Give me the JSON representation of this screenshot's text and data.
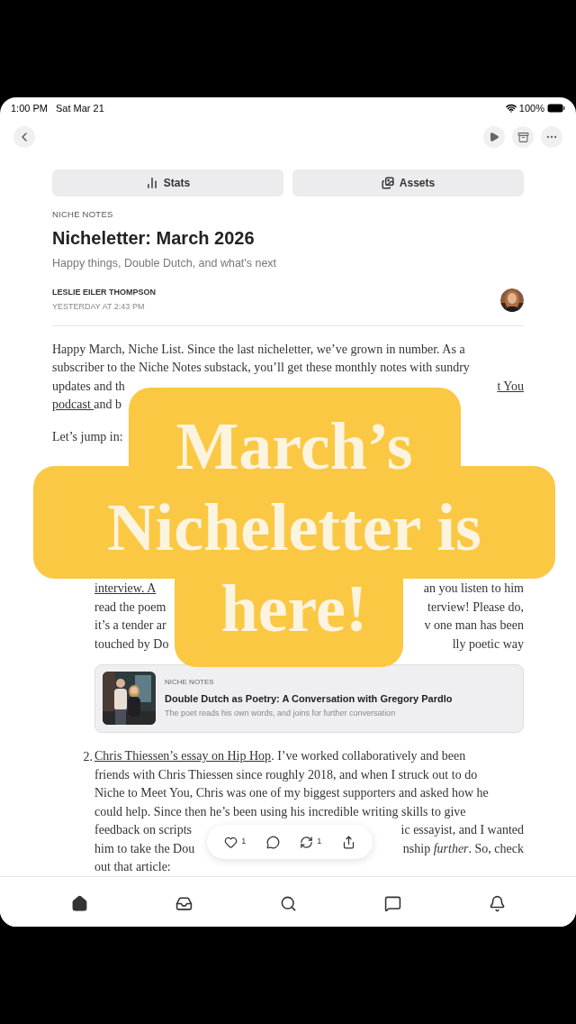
{
  "status_bar": {
    "time": "1:00 PM",
    "date": "Sat Mar 21",
    "battery": "100%"
  },
  "header_buttons": [
    {
      "label": "Stats",
      "kind": "stats"
    },
    {
      "label": "Assets",
      "kind": "assets"
    }
  ],
  "post": {
    "publication": "NICHE NOTES",
    "title": "Nicheletter: March 2026",
    "subtitle": "Happy things, Double Dutch, and what's next",
    "author": "LESLIE EILER THOMPSON",
    "time": "YESTERDAY AT 2:43 PM"
  },
  "intro_lines": [
    {
      "left": [
        {
          "text": "Happy March, Niche List. Since the last nicheletter, we’ve grown in number. As a",
          "link": false
        }
      ]
    },
    {
      "left": [
        {
          "text": "subscriber to the Niche Notes substack, you’ll get these monthly notes with sundry",
          "link": false
        }
      ]
    },
    {
      "left": [
        {
          "text": "updates and th",
          "link": false
        }
      ],
      "right": [
        {
          "text": "t You",
          "link": true
        }
      ]
    },
    {
      "left": [
        {
          "text": "podcast ",
          "link": true
        },
        {
          "text": "and b",
          "link": false
        }
      ]
    }
  ],
  "jump_line": "Let’s jump in:",
  "item1_lines": [
    {
      "left": [
        {
          "text": "interview. A",
          "link": true
        }
      ],
      "right": [
        {
          "text": "an you listen to him",
          "link": false
        }
      ]
    },
    {
      "left": [
        {
          "text": "read the poem",
          "link": false
        }
      ],
      "right": [
        {
          "text": "terview! Please do,",
          "link": false
        }
      ]
    },
    {
      "left": [
        {
          "text": "it’s a tender ar",
          "link": false
        }
      ],
      "right": [
        {
          "text": "v one man has been",
          "link": false
        }
      ]
    },
    {
      "left": [
        {
          "text": "touched by Do",
          "link": false
        }
      ],
      "right": [
        {
          "text": "lly poetic way",
          "link": false
        }
      ]
    }
  ],
  "embed": {
    "publication": "NICHE NOTES",
    "title": "Double Dutch as Poetry: A Conversation with Gregory Pardlo",
    "subtitle": "The poet reads his own words, and joins for further conversation",
    "kind": "picture"
  },
  "item2": {
    "number": "2.",
    "lines": [
      {
        "left": [
          {
            "text": "Chris Thiessen’s essay on Hip Hop",
            "link": true
          },
          {
            "text": ". I’ve worked collaboratively and been",
            "link": false
          }
        ]
      },
      {
        "left": [
          {
            "text": "friends with Chris Thiessen since roughly 2018, and when I struck out to do",
            "link": false
          }
        ]
      },
      {
        "left": [
          {
            "text": "Niche to Meet You, Chris was one of my biggest supporters and asked how he",
            "link": false
          }
        ]
      },
      {
        "left": [
          {
            "text": "could help. Since then he’s been using his incredible writing skills to give",
            "link": false
          }
        ]
      },
      {
        "left": [
          {
            "text": "feedback on scripts",
            "link": false
          }
        ],
        "right": [
          {
            "text": "ic essayist, and I wanted",
            "link": false
          }
        ]
      },
      {
        "left": [
          {
            "text": "him to take the Dou",
            "link": false
          }
        ],
        "right": [
          {
            "text": "nship *further*. So, check",
            "link": false
          }
        ]
      },
      {
        "left": [
          {
            "text": "out that article:",
            "link": false
          }
        ]
      }
    ]
  },
  "reactions": [
    {
      "kind": "like",
      "count": "1"
    },
    {
      "kind": "comment"
    },
    {
      "kind": "restack",
      "count": "1"
    },
    {
      "kind": "share"
    }
  ],
  "overlay": {
    "lines": [
      "March’s",
      "Nicheletter is",
      "here!"
    ]
  },
  "tab_bar": [
    {
      "kind": "home",
      "selected": true
    },
    {
      "kind": "inbox",
      "selected": false
    },
    {
      "kind": "search",
      "selected": false
    },
    {
      "kind": "chat",
      "selected": false
    },
    {
      "kind": "notifications",
      "selected": false
    }
  ]
}
